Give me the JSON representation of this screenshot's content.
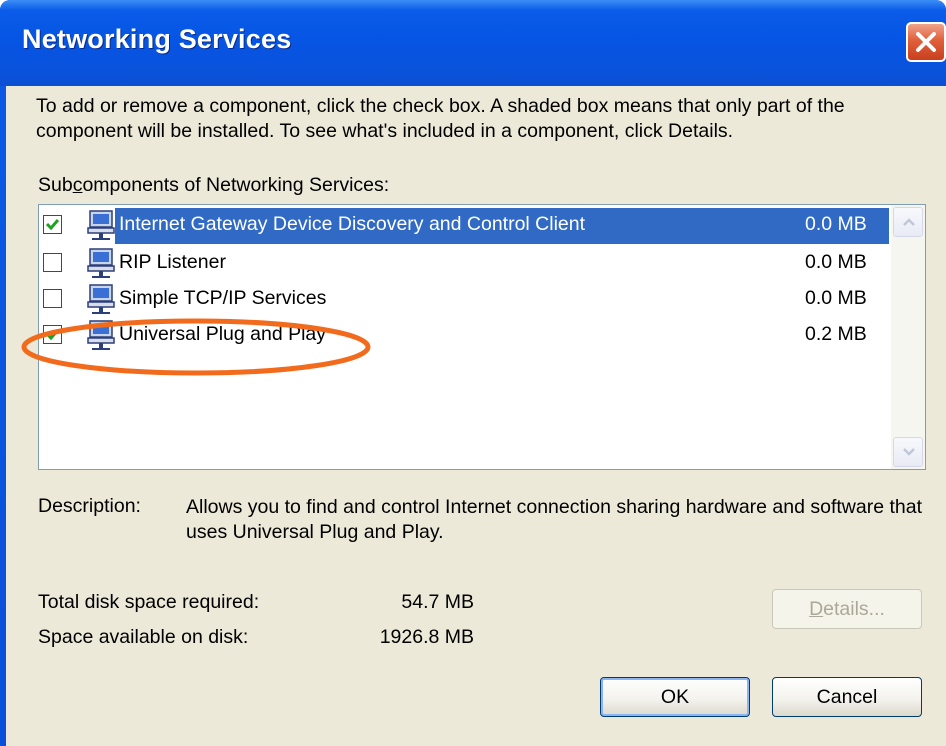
{
  "window": {
    "title": "Networking Services"
  },
  "intro_text": "To add or remove a component, click the check box. A shaded box means that only part of the component will be installed. To see what's included in a component, click Details.",
  "subcomponents_label": {
    "prefix": "Sub",
    "mnemonic": "c",
    "suffix": "omponents of Networking Services:"
  },
  "components": [
    {
      "name": "Internet Gateway Device Discovery and Control Client",
      "size": "0.0 MB",
      "checked": true,
      "selected": true,
      "icon": "network-computer-icon"
    },
    {
      "name": "RIP Listener",
      "size": "0.0 MB",
      "checked": false,
      "selected": false,
      "icon": "network-computer-icon"
    },
    {
      "name": "Simple TCP/IP Services",
      "size": "0.0 MB",
      "checked": false,
      "selected": false,
      "icon": "network-computer-icon"
    },
    {
      "name": "Universal Plug and Play",
      "size": "0.2 MB",
      "checked": true,
      "selected": false,
      "icon": "network-computer-icon"
    }
  ],
  "description": {
    "label": "Description:",
    "text": "Allows you to find and control Internet connection sharing hardware and software that uses Universal Plug and Play."
  },
  "disk": {
    "required_label": "Total disk space required:",
    "required_value": "54.7 MB",
    "available_label": "Space available on disk:",
    "available_value": "1926.8 MB"
  },
  "buttons": {
    "details_mnemonic": "D",
    "details_rest": "etails...",
    "ok": "OK",
    "cancel": "Cancel"
  },
  "colors": {
    "title_bar": "#0a55e0",
    "selection": "#316ac5",
    "dialog_face": "#ece9d8",
    "close_button": "#d9542b",
    "annotation": "#f26b1d"
  }
}
